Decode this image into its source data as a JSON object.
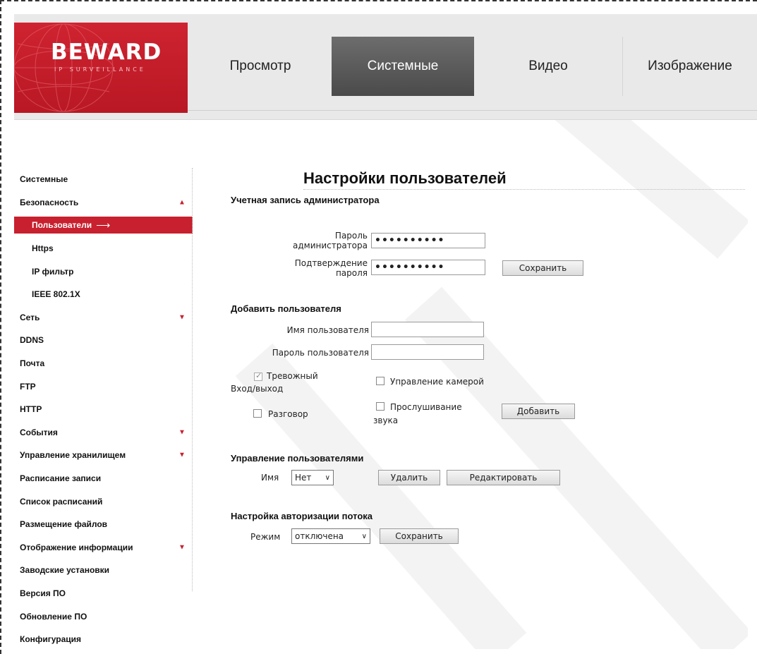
{
  "logo": {
    "name": "BEWARD",
    "tagline": "IP SURVEILLANCE"
  },
  "tabs": [
    {
      "label": "Просмотр",
      "active": false
    },
    {
      "label": "Системные",
      "active": true
    },
    {
      "label": "Видео",
      "active": false
    },
    {
      "label": "Изображение",
      "active": false
    }
  ],
  "sidebar": {
    "items": [
      {
        "label": "Системные"
      },
      {
        "label": "Безопасность",
        "caret": "▲"
      },
      {
        "label": "Пользователи",
        "active": true,
        "arrow": "⟶"
      },
      {
        "label": "Https"
      },
      {
        "label": "IP фильтр"
      },
      {
        "label": "IEEE 802.1X"
      },
      {
        "label": "Сеть",
        "caret": "▼"
      },
      {
        "label": "DDNS"
      },
      {
        "label": "Почта"
      },
      {
        "label": "FTP"
      },
      {
        "label": "HTTP"
      },
      {
        "label": "События",
        "caret": "▼"
      },
      {
        "label": "Управление хранилищем",
        "caret": "▼"
      },
      {
        "label": "Расписание записи"
      },
      {
        "label": "Список расписаний"
      },
      {
        "label": "Размещение файлов"
      },
      {
        "label": "Отображение информации",
        "caret": "▼"
      },
      {
        "label": "Заводские установки"
      },
      {
        "label": "Версия ПО"
      },
      {
        "label": "Обновление ПО"
      },
      {
        "label": "Конфигурация"
      }
    ]
  },
  "page": {
    "title": "Настройки пользователей"
  },
  "admin": {
    "section": "Учетная запись администратора",
    "password_label_1": "Пароль",
    "password_label_2": "администратора",
    "password_value": "••••••••••",
    "confirm_label_1": "Подтверждение",
    "confirm_label_2": "пароля",
    "confirm_value": "••••••••••",
    "save_label": "Сохранить"
  },
  "add_user": {
    "section": "Добавить пользователя",
    "username_label": "Имя пользователя",
    "username_value": "",
    "password_label": "Пароль пользователя",
    "password_value": "",
    "alarm_label_1": "Тревожный",
    "alarm_label_2": "Вход/выход",
    "alarm_checked": true,
    "camera_label": "Управление камерой",
    "camera_checked": false,
    "talk_label": "Разговор",
    "talk_checked": false,
    "listen_label_1": "Прослушивание",
    "listen_label_2": "звука",
    "listen_checked": false,
    "add_label": "Добавить"
  },
  "manage": {
    "section": "Управление пользователями",
    "name_label": "Имя",
    "name_value": "Нет",
    "delete_label": "Удалить",
    "edit_label": "Редактировать"
  },
  "stream_auth": {
    "section": "Настройка авторизации потока",
    "mode_label": "Режим",
    "mode_value": "отключена",
    "save_label": "Сохранить"
  },
  "colors": {
    "brand_red": "#c8202e",
    "active_tab": "#555555"
  }
}
